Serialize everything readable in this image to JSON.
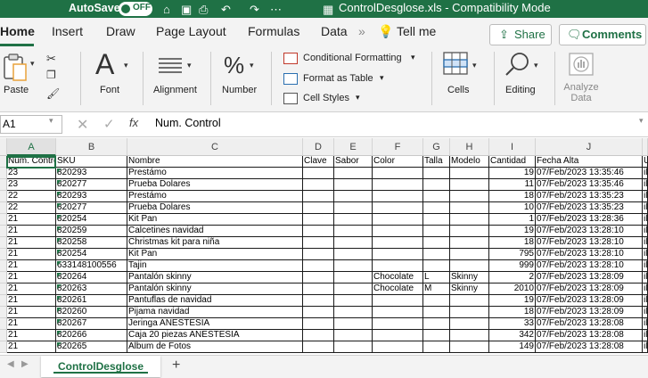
{
  "titlebar": {
    "autosave_label": "AutoSave",
    "toggle_state": "OFF",
    "doc_title": "ControlDesglose.xls  -  Compatibility Mode"
  },
  "tabs": [
    "Home",
    "Insert",
    "Draw",
    "Page Layout",
    "Formulas",
    "Data"
  ],
  "tell_me": "Tell me",
  "share_label": "Share",
  "comments_label": "Comments",
  "ribbon": {
    "paste": "Paste",
    "font": "Font",
    "alignment": "Alignment",
    "number": "Number",
    "conditional_formatting": "Conditional Formatting",
    "format_as_table": "Format as Table",
    "cell_styles": "Cell Styles",
    "cells": "Cells",
    "editing": "Editing",
    "analyze_data": "Analyze Data"
  },
  "formula_bar": {
    "name_box": "A1",
    "content": "Num. Control"
  },
  "columns": [
    "A",
    "B",
    "C",
    "D",
    "E",
    "F",
    "G",
    "H",
    "I",
    "J"
  ],
  "rows": [
    [
      "Num. Control",
      "SKU",
      "Nombre",
      "Clave",
      "Sabor",
      "Color",
      "Talla",
      "Modelo",
      "Cantidad",
      "Fecha Alta",
      "U"
    ],
    [
      "23",
      "820293",
      "Prestámo",
      "",
      "",
      "",
      "",
      "",
      "19",
      "07/Feb/2023 13:35:46",
      "il"
    ],
    [
      "23",
      "820277",
      "Prueba Dolares",
      "",
      "",
      "",
      "",
      "",
      "11",
      "07/Feb/2023 13:35:46",
      "il"
    ],
    [
      "22",
      "820293",
      "Prestámo",
      "",
      "",
      "",
      "",
      "",
      "18",
      "07/Feb/2023 13:35:23",
      "il"
    ],
    [
      "22",
      "820277",
      "Prueba Dolares",
      "",
      "",
      "",
      "",
      "",
      "10",
      "07/Feb/2023 13:35:23",
      "il"
    ],
    [
      "21",
      "820254",
      "Kit Pan",
      "",
      "",
      "",
      "",
      "",
      "1",
      "07/Feb/2023 13:28:36",
      "il"
    ],
    [
      "21",
      "820259",
      "Calcetines navidad",
      "",
      "",
      "",
      "",
      "",
      "19",
      "07/Feb/2023 13:28:10",
      "il"
    ],
    [
      "21",
      "820258",
      "Christmas kit para niña",
      "",
      "",
      "",
      "",
      "",
      "18",
      "07/Feb/2023 13:28:10",
      "il"
    ],
    [
      "21",
      "820254",
      "Kit Pan",
      "",
      "",
      "",
      "",
      "",
      "795",
      "07/Feb/2023 13:28:10",
      "il"
    ],
    [
      "21",
      "633148100556",
      "Tajin",
      "",
      "",
      "",
      "",
      "",
      "999",
      "07/Feb/2023 13:28:10",
      "il"
    ],
    [
      "21",
      "820264",
      "Pantalón skinny",
      "",
      "",
      "Chocolate",
      "L",
      "Skinny",
      "2",
      "07/Feb/2023 13:28:09",
      "il"
    ],
    [
      "21",
      "820263",
      "Pantalón skinny",
      "",
      "",
      "Chocolate",
      "M",
      "Skinny",
      "2010",
      "07/Feb/2023 13:28:09",
      "il"
    ],
    [
      "21",
      "820261",
      "Pantuflas de navidad",
      "",
      "",
      "",
      "",
      "",
      "19",
      "07/Feb/2023 13:28:09",
      "il"
    ],
    [
      "21",
      "820260",
      "Pijama navidad",
      "",
      "",
      "",
      "",
      "",
      "18",
      "07/Feb/2023 13:28:09",
      "il"
    ],
    [
      "21",
      "820267",
      "Jeringa ANESTESIA",
      "",
      "",
      "",
      "",
      "",
      "33",
      "07/Feb/2023 13:28:08",
      "il"
    ],
    [
      "21",
      "820266",
      "Caja 20 piezas ANESTESIA",
      "",
      "",
      "",
      "",
      "",
      "342",
      "07/Feb/2023 13:28:08",
      "il"
    ],
    [
      "21",
      "820265",
      "Album de Fotos",
      "",
      "",
      "",
      "",
      "",
      "149",
      "07/Feb/2023 13:28:08",
      "il"
    ]
  ],
  "sheet_tab": "ControlDesglose",
  "accent": "#1f7145"
}
